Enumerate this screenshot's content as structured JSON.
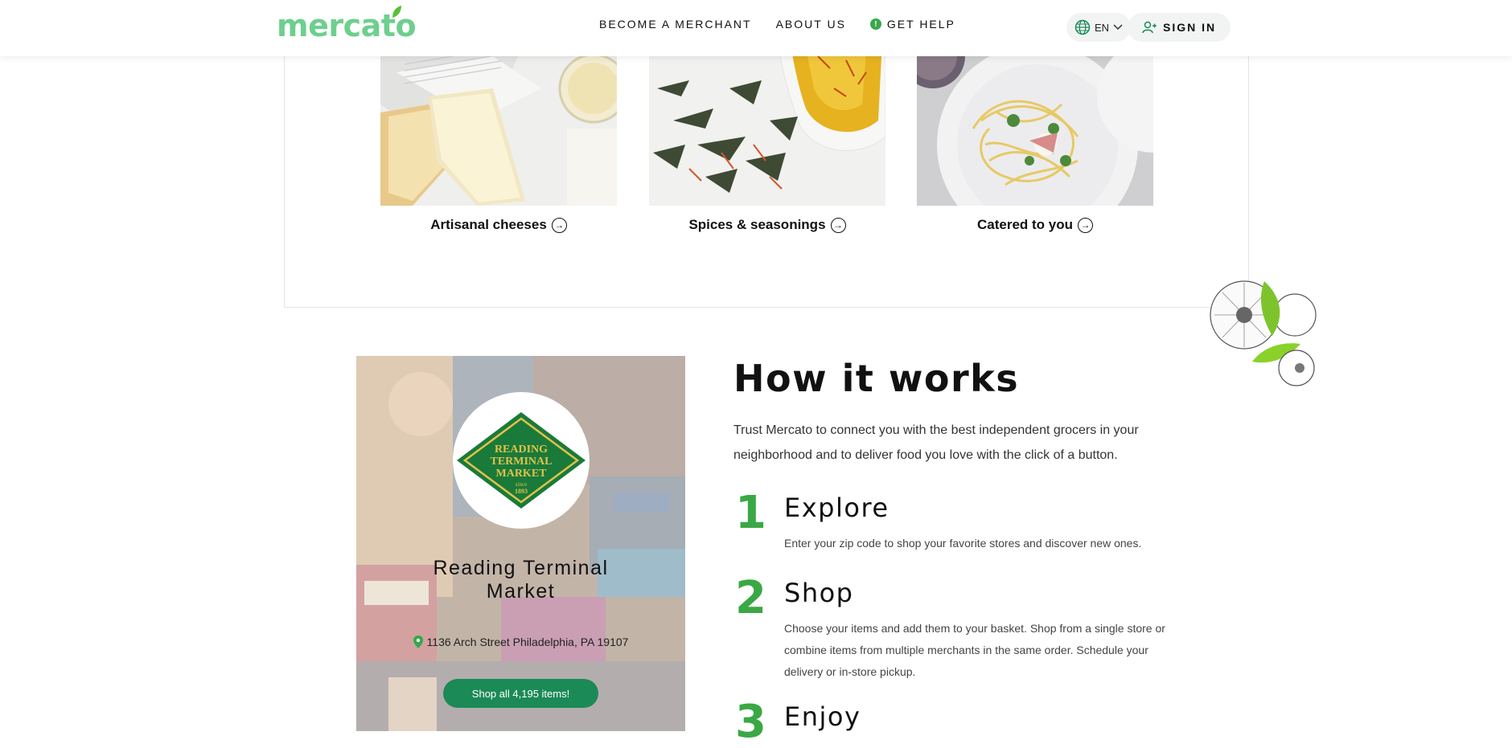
{
  "header": {
    "logo_text": "mercato",
    "nav": [
      {
        "label": "BECOME A MERCHANT"
      },
      {
        "label": "ABOUT US"
      },
      {
        "label": "GET HELP",
        "icon": "info-icon"
      }
    ],
    "language": "EN",
    "signin_label": "SIGN IN"
  },
  "categories": [
    {
      "label": "Artisanal cheeses",
      "image": "cheese-photo"
    },
    {
      "label": "Spices & seasonings",
      "image": "spices-photo"
    },
    {
      "label": "Catered to you",
      "image": "pasta-photo"
    }
  ],
  "market": {
    "logo_lines": [
      "READING",
      "TERMINAL",
      "MARKET",
      "since",
      "1893"
    ],
    "name": "Reading Terminal Market",
    "address": "1136 Arch Street Philadelphia, PA 19107",
    "shop_button": "Shop all 4,195 items!"
  },
  "how": {
    "title": "How it works",
    "intro": "Trust Mercato to connect you with the best independent grocers in your neighborhood and to deliver food you love with the click of a button.",
    "steps": [
      {
        "number": "1",
        "title": "Explore",
        "description": "Enter your zip code to shop your favorite stores and discover new ones."
      },
      {
        "number": "2",
        "title": "Shop",
        "description": "Choose your items and add them to your basket. Shop from a single store or combine items from multiple merchants in the same order. Schedule your delivery or in-store pickup."
      },
      {
        "number": "3",
        "title": "Enjoy",
        "description": ""
      }
    ]
  },
  "colors": {
    "brand_green": "#6ecf8e",
    "accent_green": "#3aa844",
    "button_green": "#1b8a57"
  }
}
